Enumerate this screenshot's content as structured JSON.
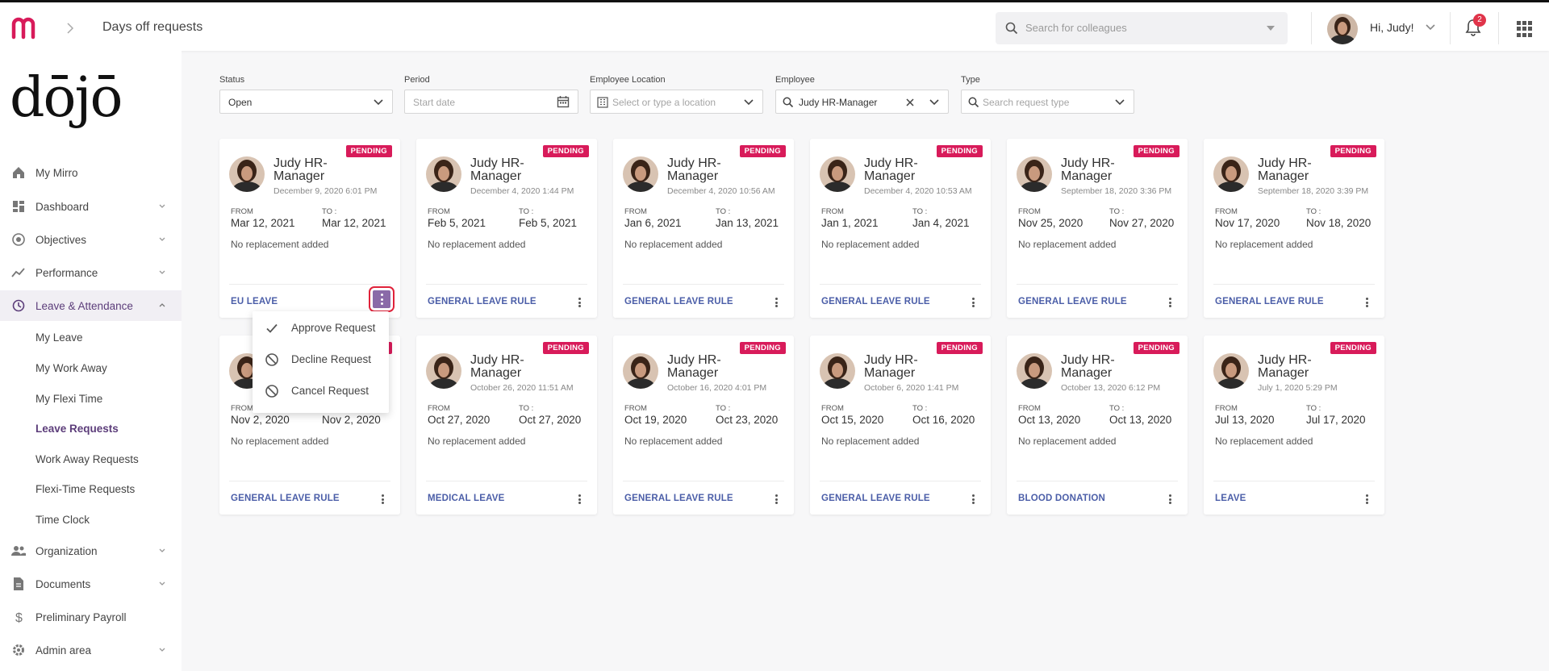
{
  "header": {
    "page_title": "Days off requests",
    "search_placeholder": "Search for colleagues",
    "greeting": "Hi, Judy!",
    "notification_count": "2"
  },
  "sidebar": {
    "brand": "dōjō",
    "items": [
      {
        "label": "My Mirro",
        "icon": "home-icon"
      },
      {
        "label": "Dashboard",
        "icon": "dashboard-icon"
      },
      {
        "label": "Objectives",
        "icon": "target-icon"
      },
      {
        "label": "Performance",
        "icon": "trend-icon"
      },
      {
        "label": "Leave & Attendance",
        "icon": "history-icon"
      },
      {
        "label": "Organization",
        "icon": "people-icon"
      },
      {
        "label": "Documents",
        "icon": "document-icon"
      },
      {
        "label": "Preliminary Payroll",
        "icon": "dollar-icon"
      },
      {
        "label": "Admin area",
        "icon": "gear-icon"
      }
    ],
    "sub_items": [
      "My Leave",
      "My Work Away",
      "My Flexi Time",
      "Leave Requests",
      "Work Away Requests",
      "Flexi-Time Requests",
      "Time Clock"
    ]
  },
  "filters": {
    "status": {
      "label": "Status",
      "value": "Open"
    },
    "period": {
      "label": "Period",
      "placeholder": "Start date"
    },
    "location": {
      "label": "Employee Location",
      "placeholder": "Select or type a location"
    },
    "employee": {
      "label": "Employee",
      "value": "Judy HR-Manager"
    },
    "type": {
      "label": "Type",
      "placeholder": "Search request type"
    }
  },
  "card_labels": {
    "from": "FROM",
    "to": "TO :",
    "no_replacement": "No replacement added",
    "status": "PENDING"
  },
  "cards": [
    {
      "name": "Judy HR-Manager",
      "date": "December 9, 2020 6:01 PM",
      "from": "Mar 12, 2021",
      "to": "Mar 12, 2021",
      "rule": "EU LEAVE"
    },
    {
      "name": "Judy HR-Manager",
      "date": "December 4, 2020 1:44 PM",
      "from": "Feb 5, 2021",
      "to": "Feb 5, 2021",
      "rule": "GENERAL LEAVE RULE"
    },
    {
      "name": "Judy HR-Manager",
      "date": "December 4, 2020 10:56 AM",
      "from": "Jan 6, 2021",
      "to": "Jan 13, 2021",
      "rule": "GENERAL LEAVE RULE"
    },
    {
      "name": "Judy HR-Manager",
      "date": "December 4, 2020 10:53 AM",
      "from": "Jan 1, 2021",
      "to": "Jan 4, 2021",
      "rule": "GENERAL LEAVE RULE"
    },
    {
      "name": "Judy HR-Manager",
      "date": "September 18, 2020 3:36 PM",
      "from": "Nov 25, 2020",
      "to": "Nov 27, 2020",
      "rule": "GENERAL LEAVE RULE"
    },
    {
      "name": "Judy HR-Manager",
      "date": "September 18, 2020 3:39 PM",
      "from": "Nov 17, 2020",
      "to": "Nov 18, 2020",
      "rule": "GENERAL LEAVE RULE"
    },
    {
      "name": "Judy HR-Manager",
      "date": "",
      "from": "Nov 2, 2020",
      "to": "Nov 2, 2020",
      "rule": "GENERAL LEAVE RULE"
    },
    {
      "name": "Judy HR-Manager",
      "date": "October 26, 2020 11:51 AM",
      "from": "Oct 27, 2020",
      "to": "Oct 27, 2020",
      "rule": "MEDICAL LEAVE"
    },
    {
      "name": "Judy HR-Manager",
      "date": "October 16, 2020 4:01 PM",
      "from": "Oct 19, 2020",
      "to": "Oct 23, 2020",
      "rule": "GENERAL LEAVE RULE"
    },
    {
      "name": "Judy HR-Manager",
      "date": "October 6, 2020 1:41 PM",
      "from": "Oct 15, 2020",
      "to": "Oct 16, 2020",
      "rule": "GENERAL LEAVE RULE"
    },
    {
      "name": "Judy HR-Manager",
      "date": "October 13, 2020 6:12 PM",
      "from": "Oct 13, 2020",
      "to": "Oct 13, 2020",
      "rule": "BLOOD DONATION"
    },
    {
      "name": "Judy HR-Manager",
      "date": "July 1, 2020 5:29 PM",
      "from": "Jul 13, 2020",
      "to": "Jul 17, 2020",
      "rule": "LEAVE"
    }
  ],
  "context_menu": [
    {
      "label": "Approve Request",
      "icon": "check-icon"
    },
    {
      "label": "Decline Request",
      "icon": "block-icon"
    },
    {
      "label": "Cancel Request",
      "icon": "block-icon"
    }
  ],
  "colors": {
    "accent": "#5c3d7a",
    "badge": "#d81b5a",
    "rule_link": "#4b5ea8",
    "logo": "#d81b5a"
  }
}
